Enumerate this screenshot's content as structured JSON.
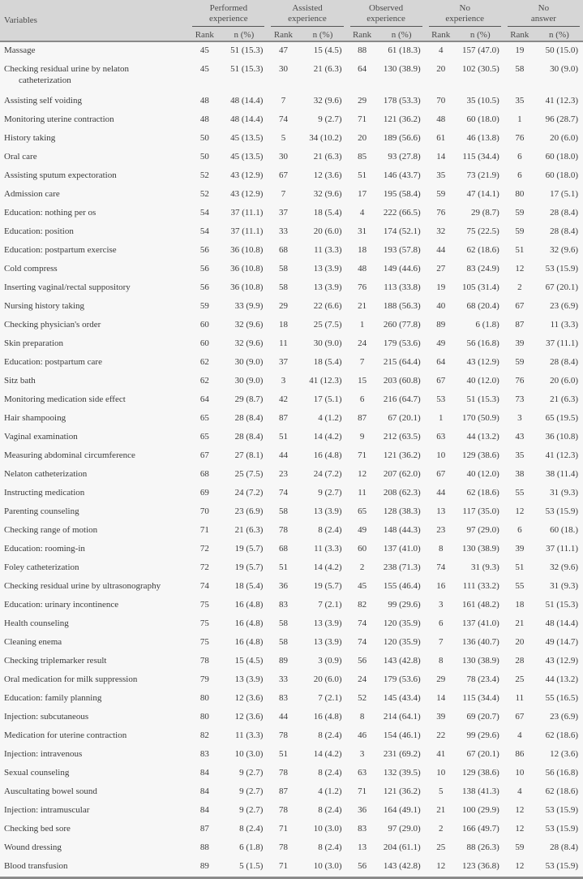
{
  "table": {
    "header": {
      "variables_label": "Variables",
      "groups": [
        {
          "line1": "Performed",
          "line2": "experience"
        },
        {
          "line1": "Assisted",
          "line2": "experience"
        },
        {
          "line1": "Observed",
          "line2": "experience"
        },
        {
          "line1": "No",
          "line2": "experience"
        },
        {
          "line1": "No",
          "line2": "answer"
        }
      ],
      "rank_label": "Rank",
      "n_label": "n (%)"
    },
    "rows": [
      {
        "name": "Massage",
        "cells": [
          "45",
          "51 (15.3)",
          "47",
          "15 (4.5)",
          "88",
          "61 (18.3)",
          "4",
          "157 (47.0)",
          "19",
          "50 (15.0)"
        ]
      },
      {
        "name": "Checking residual urine by nelaton",
        "name2": "catheterization",
        "cells": [
          "45",
          "51 (15.3)",
          "30",
          "21 (6.3)",
          "64",
          "130 (38.9)",
          "20",
          "102 (30.5)",
          "58",
          "30 (9.0)"
        ]
      },
      {
        "name": "Assisting self voiding",
        "cells": [
          "48",
          "48 (14.4)",
          "7",
          "32 (9.6)",
          "29",
          "178 (53.3)",
          "70",
          "35 (10.5)",
          "35",
          "41 (12.3)"
        ]
      },
      {
        "name": "Monitoring uterine contraction",
        "cells": [
          "48",
          "48 (14.4)",
          "74",
          "9 (2.7)",
          "71",
          "121 (36.2)",
          "48",
          "60 (18.0)",
          "1",
          "96 (28.7)"
        ]
      },
      {
        "name": "History taking",
        "cells": [
          "50",
          "45 (13.5)",
          "5",
          "34 (10.2)",
          "20",
          "189 (56.6)",
          "61",
          "46 (13.8)",
          "76",
          "20 (6.0)"
        ]
      },
      {
        "name": "Oral care",
        "cells": [
          "50",
          "45 (13.5)",
          "30",
          "21 (6.3)",
          "85",
          "93 (27.8)",
          "14",
          "115 (34.4)",
          "6",
          "60 (18.0)"
        ]
      },
      {
        "name": "Assisting sputum expectoration",
        "cells": [
          "52",
          "43 (12.9)",
          "67",
          "12 (3.6)",
          "51",
          "146 (43.7)",
          "35",
          "73 (21.9)",
          "6",
          "60 (18.0)"
        ]
      },
      {
        "name": "Admission care",
        "cells": [
          "52",
          "43 (12.9)",
          "7",
          "32 (9.6)",
          "17",
          "195 (58.4)",
          "59",
          "47 (14.1)",
          "80",
          "17 (5.1)"
        ]
      },
      {
        "name": "Education: nothing per os",
        "cells": [
          "54",
          "37 (11.1)",
          "37",
          "18 (5.4)",
          "4",
          "222 (66.5)",
          "76",
          "29 (8.7)",
          "59",
          "28 (8.4)"
        ]
      },
      {
        "name": "Education: position",
        "cells": [
          "54",
          "37 (11.1)",
          "33",
          "20 (6.0)",
          "31",
          "174 (52.1)",
          "32",
          "75 (22.5)",
          "59",
          "28 (8.4)"
        ]
      },
      {
        "name": "Education: postpartum exercise",
        "cells": [
          "56",
          "36 (10.8)",
          "68",
          "11 (3.3)",
          "18",
          "193 (57.8)",
          "44",
          "62 (18.6)",
          "51",
          "32 (9.6)"
        ]
      },
      {
        "name": "Cold compress",
        "cells": [
          "56",
          "36 (10.8)",
          "58",
          "13 (3.9)",
          "48",
          "149 (44.6)",
          "27",
          "83 (24.9)",
          "12",
          "53 (15.9)"
        ]
      },
      {
        "name": "Inserting vaginal/rectal suppository",
        "cells": [
          "56",
          "36 (10.8)",
          "58",
          "13 (3.9)",
          "76",
          "113 (33.8)",
          "19",
          "105 (31.4)",
          "2",
          "67 (20.1)"
        ]
      },
      {
        "name": "Nursing history taking",
        "cells": [
          "59",
          "33 (9.9)",
          "29",
          "22 (6.6)",
          "21",
          "188 (56.3)",
          "40",
          "68 (20.4)",
          "67",
          "23 (6.9)"
        ]
      },
      {
        "name": "Checking physician's order",
        "cells": [
          "60",
          "32 (9.6)",
          "18",
          "25 (7.5)",
          "1",
          "260 (77.8)",
          "89",
          "6 (1.8)",
          "87",
          "11 (3.3)"
        ]
      },
      {
        "name": "Skin preparation",
        "cells": [
          "60",
          "32 (9.6)",
          "11",
          "30 (9.0)",
          "24",
          "179 (53.6)",
          "49",
          "56 (16.8)",
          "39",
          "37 (11.1)"
        ]
      },
      {
        "name": "Education: postpartum care",
        "cells": [
          "62",
          "30 (9.0)",
          "37",
          "18 (5.4)",
          "7",
          "215 (64.4)",
          "64",
          "43 (12.9)",
          "59",
          "28 (8.4)"
        ]
      },
      {
        "name": "Sitz bath",
        "cells": [
          "62",
          "30 (9.0)",
          "3",
          "41 (12.3)",
          "15",
          "203 (60.8)",
          "67",
          "40 (12.0)",
          "76",
          "20 (6.0)"
        ]
      },
      {
        "name": "Monitoring medication side effect",
        "cells": [
          "64",
          "29 (8.7)",
          "42",
          "17 (5.1)",
          "6",
          "216 (64.7)",
          "53",
          "51 (15.3)",
          "73",
          "21 (6.3)"
        ]
      },
      {
        "name": "Hair shampooing",
        "cells": [
          "65",
          "28 (8.4)",
          "87",
          "4 (1.2)",
          "87",
          "67 (20.1)",
          "1",
          "170 (50.9)",
          "3",
          "65 (19.5)"
        ]
      },
      {
        "name": "Vaginal examination",
        "cells": [
          "65",
          "28 (8.4)",
          "51",
          "14 (4.2)",
          "9",
          "212 (63.5)",
          "63",
          "44 (13.2)",
          "43",
          "36 (10.8)"
        ]
      },
      {
        "name": "Measuring abdominal circumference",
        "cells": [
          "67",
          "27 (8.1)",
          "44",
          "16 (4.8)",
          "71",
          "121 (36.2)",
          "10",
          "129 (38.6)",
          "35",
          "41 (12.3)"
        ]
      },
      {
        "name": "Nelaton catheterization",
        "cells": [
          "68",
          "25 (7.5)",
          "23",
          "24 (7.2)",
          "12",
          "207 (62.0)",
          "67",
          "40 (12.0)",
          "38",
          "38 (11.4)"
        ]
      },
      {
        "name": "Instructing medication",
        "cells": [
          "69",
          "24 (7.2)",
          "74",
          "9 (2.7)",
          "11",
          "208 (62.3)",
          "44",
          "62 (18.6)",
          "55",
          "31 (9.3)"
        ]
      },
      {
        "name": "Parenting counseling",
        "cells": [
          "70",
          "23 (6.9)",
          "58",
          "13 (3.9)",
          "65",
          "128 (38.3)",
          "13",
          "117 (35.0)",
          "12",
          "53 (15.9)"
        ]
      },
      {
        "name": "Checking range of motion",
        "cells": [
          "71",
          "21 (6.3)",
          "78",
          "8 (2.4)",
          "49",
          "148 (44.3)",
          "23",
          "97 (29.0)",
          "6",
          "60 (18.)"
        ]
      },
      {
        "name": "Education: rooming-in",
        "cells": [
          "72",
          "19 (5.7)",
          "68",
          "11 (3.3)",
          "60",
          "137 (41.0)",
          "8",
          "130 (38.9)",
          "39",
          "37 (11.1)"
        ]
      },
      {
        "name": "Foley catheterization",
        "cells": [
          "72",
          "19 (5.7)",
          "51",
          "14 (4.2)",
          "2",
          "238 (71.3)",
          "74",
          "31 (9.3)",
          "51",
          "32 (9.6)"
        ]
      },
      {
        "name": "Checking residual urine by ultrasonography",
        "cells": [
          "74",
          "18 (5.4)",
          "36",
          "19 (5.7)",
          "45",
          "155 (46.4)",
          "16",
          "111 (33.2)",
          "55",
          "31 (9.3)"
        ]
      },
      {
        "name": "Education: urinary incontinence",
        "cells": [
          "75",
          "16 (4.8)",
          "83",
          "7 (2.1)",
          "82",
          "99 (29.6)",
          "3",
          "161 (48.2)",
          "18",
          "51 (15.3)"
        ]
      },
      {
        "name": "Health counseling",
        "cells": [
          "75",
          "16 (4.8)",
          "58",
          "13 (3.9)",
          "74",
          "120 (35.9)",
          "6",
          "137 (41.0)",
          "21",
          "48 (14.4)"
        ]
      },
      {
        "name": "Cleaning enema",
        "cells": [
          "75",
          "16 (4.8)",
          "58",
          "13 (3.9)",
          "74",
          "120 (35.9)",
          "7",
          "136 (40.7)",
          "20",
          "49 (14.7)"
        ]
      },
      {
        "name": "Checking triplemarker result",
        "cells": [
          "78",
          "15 (4.5)",
          "89",
          "3 (0.9)",
          "56",
          "143 (42.8)",
          "8",
          "130 (38.9)",
          "28",
          "43 (12.9)"
        ]
      },
      {
        "name": "Oral medication for milk suppression",
        "cells": [
          "79",
          "13 (3.9)",
          "33",
          "20 (6.0)",
          "24",
          "179 (53.6)",
          "29",
          "78 (23.4)",
          "25",
          "44 (13.2)"
        ]
      },
      {
        "name": "Education: family planning",
        "cells": [
          "80",
          "12 (3.6)",
          "83",
          "7 (2.1)",
          "52",
          "145 (43.4)",
          "14",
          "115 (34.4)",
          "11",
          "55 (16.5)"
        ]
      },
      {
        "name": "Injection: subcutaneous",
        "cells": [
          "80",
          "12 (3.6)",
          "44",
          "16 (4.8)",
          "8",
          "214 (64.1)",
          "39",
          "69 (20.7)",
          "67",
          "23 (6.9)"
        ]
      },
      {
        "name": "Medication for uterine contraction",
        "cells": [
          "82",
          "11 (3.3)",
          "78",
          "8 (2.4)",
          "46",
          "154 (46.1)",
          "22",
          "99 (29.6)",
          "4",
          "62 (18.6)"
        ]
      },
      {
        "name": "Injection: intravenous",
        "cells": [
          "83",
          "10 (3.0)",
          "51",
          "14 (4.2)",
          "3",
          "231 (69.2)",
          "41",
          "67 (20.1)",
          "86",
          "12 (3.6)"
        ]
      },
      {
        "name": "Sexual counseling",
        "cells": [
          "84",
          "9 (2.7)",
          "78",
          "8 (2.4)",
          "63",
          "132 (39.5)",
          "10",
          "129 (38.6)",
          "10",
          "56 (16.8)"
        ]
      },
      {
        "name": "Auscultating bowel sound",
        "cells": [
          "84",
          "9 (2.7)",
          "87",
          "4 (1.2)",
          "71",
          "121 (36.2)",
          "5",
          "138 (41.3)",
          "4",
          "62 (18.6)"
        ]
      },
      {
        "name": "Injection: intramuscular",
        "cells": [
          "84",
          "9 (2.7)",
          "78",
          "8 (2.4)",
          "36",
          "164 (49.1)",
          "21",
          "100 (29.9)",
          "12",
          "53 (15.9)"
        ]
      },
      {
        "name": "Checking bed sore",
        "cells": [
          "87",
          "8 (2.4)",
          "71",
          "10 (3.0)",
          "83",
          "97 (29.0)",
          "2",
          "166 (49.7)",
          "12",
          "53 (15.9)"
        ]
      },
      {
        "name": "Wound dressing",
        "cells": [
          "88",
          "6 (1.8)",
          "78",
          "8 (2.4)",
          "13",
          "204 (61.1)",
          "25",
          "88 (26.3)",
          "59",
          "28 (8.4)"
        ]
      },
      {
        "name": "Blood transfusion",
        "cells": [
          "89",
          "5 (1.5)",
          "71",
          "10 (3.0)",
          "56",
          "143 (42.8)",
          "12",
          "123 (36.8)",
          "12",
          "53 (15.9)"
        ]
      }
    ]
  }
}
